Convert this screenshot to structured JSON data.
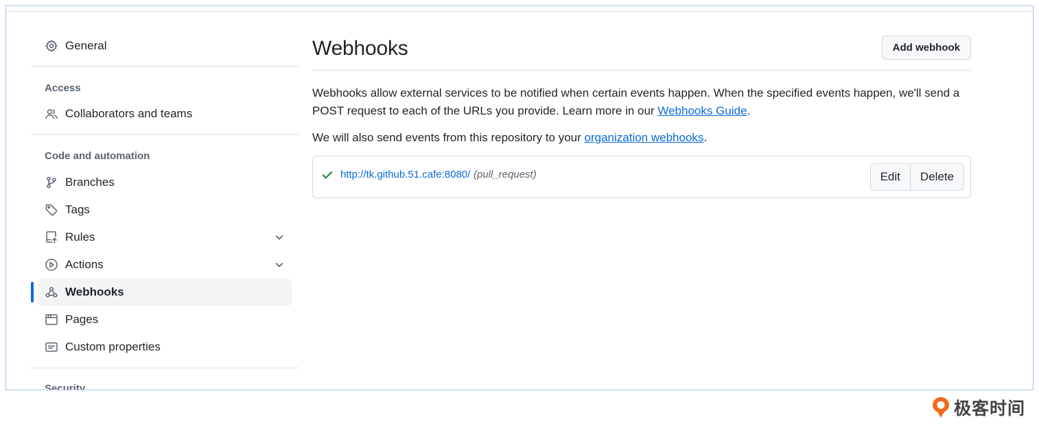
{
  "sidebar": {
    "general_label": "General",
    "access_heading": "Access",
    "collaborators_label": "Collaborators and teams",
    "code_heading": "Code and automation",
    "branches_label": "Branches",
    "tags_label": "Tags",
    "rules_label": "Rules",
    "actions_label": "Actions",
    "webhooks_label": "Webhooks",
    "pages_label": "Pages",
    "custom_properties_label": "Custom properties",
    "security_heading": "Security",
    "active_item": "Webhooks"
  },
  "main": {
    "title": "Webhooks",
    "add_button": "Add webhook",
    "desc_text": "Webhooks allow external services to be notified when certain events happen. When the specified events happen, we'll send a POST request to each of the URLs you provide. Learn more in our ",
    "desc_link": "Webhooks Guide",
    "desc_end": ".",
    "org_text": "We will also send events from this repository to your ",
    "org_link": "organization webhooks",
    "org_end": "."
  },
  "webhook": {
    "status": "success",
    "url": "http://tk.github.51.cafe:8080/",
    "events": "(pull_request)",
    "edit_button": "Edit",
    "delete_button": "Delete"
  },
  "watermark": {
    "text": "极客时间"
  },
  "colors": {
    "link": "#0969da",
    "success": "#1a7f37",
    "active_indicator": "#0969da",
    "frame_border": "#a9c3ee",
    "brand_orange": "#f26b21"
  }
}
